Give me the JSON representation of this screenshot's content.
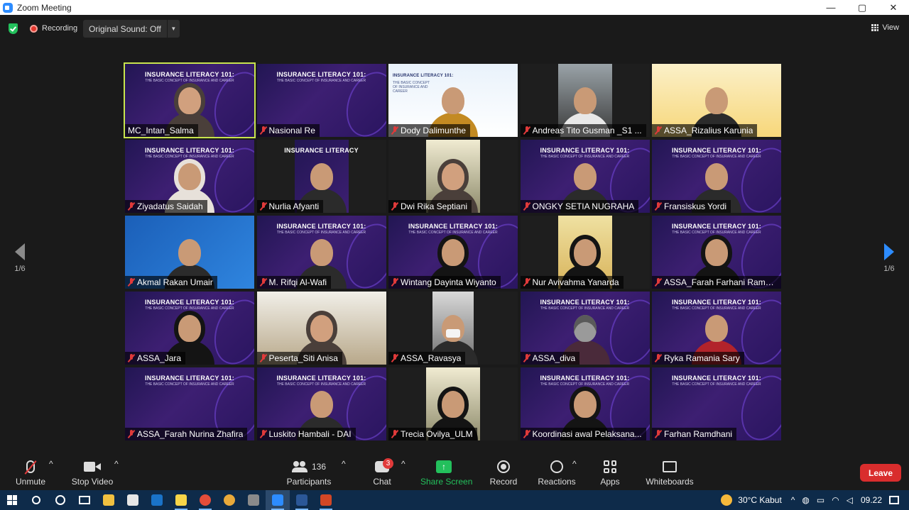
{
  "window": {
    "title": "Zoom Meeting",
    "minimize": "—",
    "restore": "▢",
    "close": "✕"
  },
  "topbar": {
    "recording": "Recording",
    "original_sound": "Original Sound: Off",
    "view": "View"
  },
  "tiles": [
    {
      "name": "MC_Intan_Salma",
      "bg": "banner",
      "banner": "INSURANCE LITERACY 101:",
      "banner_sub": "THE BASIC CONCEPT OF INSURANCE AND CAREER",
      "person": "hijab",
      "muted": false,
      "active": true
    },
    {
      "name": "Nasional Re",
      "bg": "banner",
      "banner": "INSURANCE LITERACY 101:",
      "banner_sub": "THE BASIC CONCEPT OF INSURANCE AND CAREER",
      "person": "none",
      "muted": true,
      "active": false
    },
    {
      "name": "Dody Dalimunthe",
      "bg": "light",
      "banner": "INSURANCE LITERACY 101:",
      "banner_sub": "THE BASIC CONCEPT OF INSURANCE AND CAREER",
      "person": "orange",
      "muted": true,
      "active": false
    },
    {
      "name": "Andreas Tito Gusman _S1 ...",
      "bg": "dark",
      "cam": "narrow",
      "person": "white",
      "muted": true,
      "active": false
    },
    {
      "name": "ASSA_Rizalius Karunia",
      "bg": "warm",
      "person": "plain",
      "muted": true,
      "active": false
    },
    {
      "name": "Ziyadatus Saidah",
      "bg": "banner",
      "banner": "INSURANCE LITERACY 101:",
      "banner_sub": "THE BASIC CONCEPT OF INSURANCE AND CAREER",
      "person": "light",
      "muted": true,
      "active": false
    },
    {
      "name": "Nurlia Afyanti",
      "bg": "dark",
      "cam": "banner",
      "banner": "INSURANCE LITERACY",
      "person": "plain",
      "muted": true,
      "active": false
    },
    {
      "name": "Dwi Rika Septiani",
      "bg": "dark",
      "cam": "green",
      "person": "hijab",
      "muted": true,
      "active": false
    },
    {
      "name": "ONGKY SETIA NUGRAHA",
      "bg": "banner",
      "banner": "INSURANCE LITERACY 101:",
      "banner_sub": "THE BASIC CONCEPT OF INSURANCE AND CAREER",
      "person": "plain",
      "muted": true,
      "active": false
    },
    {
      "name": "Fransiskus Yordi",
      "bg": "banner",
      "banner": "INSURANCE LITERACY 101:",
      "banner_sub": "THE BASIC CONCEPT OF INSURANCE AND CAREER",
      "person": "plain",
      "muted": true,
      "active": false
    },
    {
      "name": "Akmal Rakan Umair",
      "bg": "blue",
      "person": "plain",
      "muted": true,
      "active": false
    },
    {
      "name": "M. Rifqi Al-Wafi",
      "bg": "banner",
      "banner": "INSURANCE LITERACY 101:",
      "banner_sub": "THE BASIC CONCEPT OF INSURANCE AND CAREER",
      "person": "plain",
      "muted": true,
      "active": false
    },
    {
      "name": "Wintang Dayinta Wiyanto",
      "bg": "banner",
      "banner": "INSURANCE LITERACY 101:",
      "banner_sub": "THE BASIC CONCEPT OF INSURANCE AND CAREER",
      "person": "black",
      "muted": true,
      "active": false
    },
    {
      "name": "Nur Avivahma Yanarda",
      "bg": "dark",
      "cam": "warm",
      "person": "black",
      "muted": true,
      "active": false
    },
    {
      "name": "ASSA_Farah Farhani Ramad...",
      "bg": "banner",
      "banner": "INSURANCE LITERACY 101:",
      "banner_sub": "THE BASIC CONCEPT OF INSURANCE AND CAREER",
      "person": "black",
      "muted": true,
      "active": false
    },
    {
      "name": "ASSA_Jara",
      "bg": "banner",
      "banner": "INSURANCE LITERACY 101:",
      "banner_sub": "THE BASIC CONCEPT OF INSURANCE AND CAREER",
      "person": "black",
      "muted": true,
      "active": false
    },
    {
      "name": "Peserta_Siti Anisa",
      "bg": "room",
      "person": "hijab",
      "muted": true,
      "active": false
    },
    {
      "name": "ASSA_Ravasya",
      "bg": "dark",
      "cam": "pale",
      "person": "mask",
      "muted": true,
      "active": false
    },
    {
      "name": "ASSA_diva",
      "bg": "banner",
      "banner": "INSURANCE LITERACY 101:",
      "banner_sub": "THE BASIC CONCEPT OF INSURANCE AND CAREER",
      "person": "raccoon",
      "muted": true,
      "active": false
    },
    {
      "name": "Ryka Ramania Sary",
      "bg": "banner",
      "banner": "INSURANCE LITERACY 101:",
      "banner_sub": "THE BASIC CONCEPT OF INSURANCE AND CAREER",
      "person": "red",
      "muted": true,
      "active": false
    },
    {
      "name": "ASSA_Farah Nurina Zhafira",
      "bg": "banner",
      "banner": "INSURANCE LITERACY 101:",
      "banner_sub": "THE BASIC CONCEPT OF INSURANCE AND CAREER",
      "person": "none",
      "muted": true,
      "active": false
    },
    {
      "name": "Luskito Hambali - DAI",
      "bg": "banner",
      "banner": "INSURANCE LITERACY 101:",
      "banner_sub": "THE BASIC CONCEPT OF INSURANCE AND CAREER",
      "person": "plain",
      "muted": true,
      "active": false
    },
    {
      "name": "Trecia Ovilya_ULM",
      "bg": "dark",
      "cam": "green",
      "person": "black",
      "muted": true,
      "active": false
    },
    {
      "name": "Koordinasi awal Pelaksana...",
      "bg": "banner",
      "banner": "INSURANCE LITERACY 101:",
      "banner_sub": "THE BASIC CONCEPT OF INSURANCE AND CAREER",
      "person": "black",
      "muted": true,
      "active": false
    },
    {
      "name": "Farhan Ramdhani",
      "bg": "banner",
      "banner": "INSURANCE LITERACY 101:",
      "banner_sub": "THE BASIC CONCEPT OF INSURANCE AND CAREER",
      "person": "none",
      "muted": true,
      "active": false
    }
  ],
  "pager": {
    "left": "1/6",
    "right": "1/6"
  },
  "toolbar": {
    "unmute": "Unmute",
    "stop_video": "Stop Video",
    "participants": "Participants",
    "participants_count": "136",
    "chat": "Chat",
    "chat_badge": "3",
    "share_screen": "Share Screen",
    "share_arrow": "↑",
    "record": "Record",
    "reactions": "Reactions",
    "apps": "Apps",
    "whiteboards": "Whiteboards",
    "leave": "Leave",
    "caret": "^"
  },
  "taskbar": {
    "weather": "30°C  Kabut",
    "tray_chevron": "^",
    "clock": "09.22"
  },
  "colors": {
    "accent_blue": "#2d8cff",
    "share_green": "#23c05c",
    "leave_red": "#d92d2d",
    "active_speaker": "#c8e44e"
  }
}
